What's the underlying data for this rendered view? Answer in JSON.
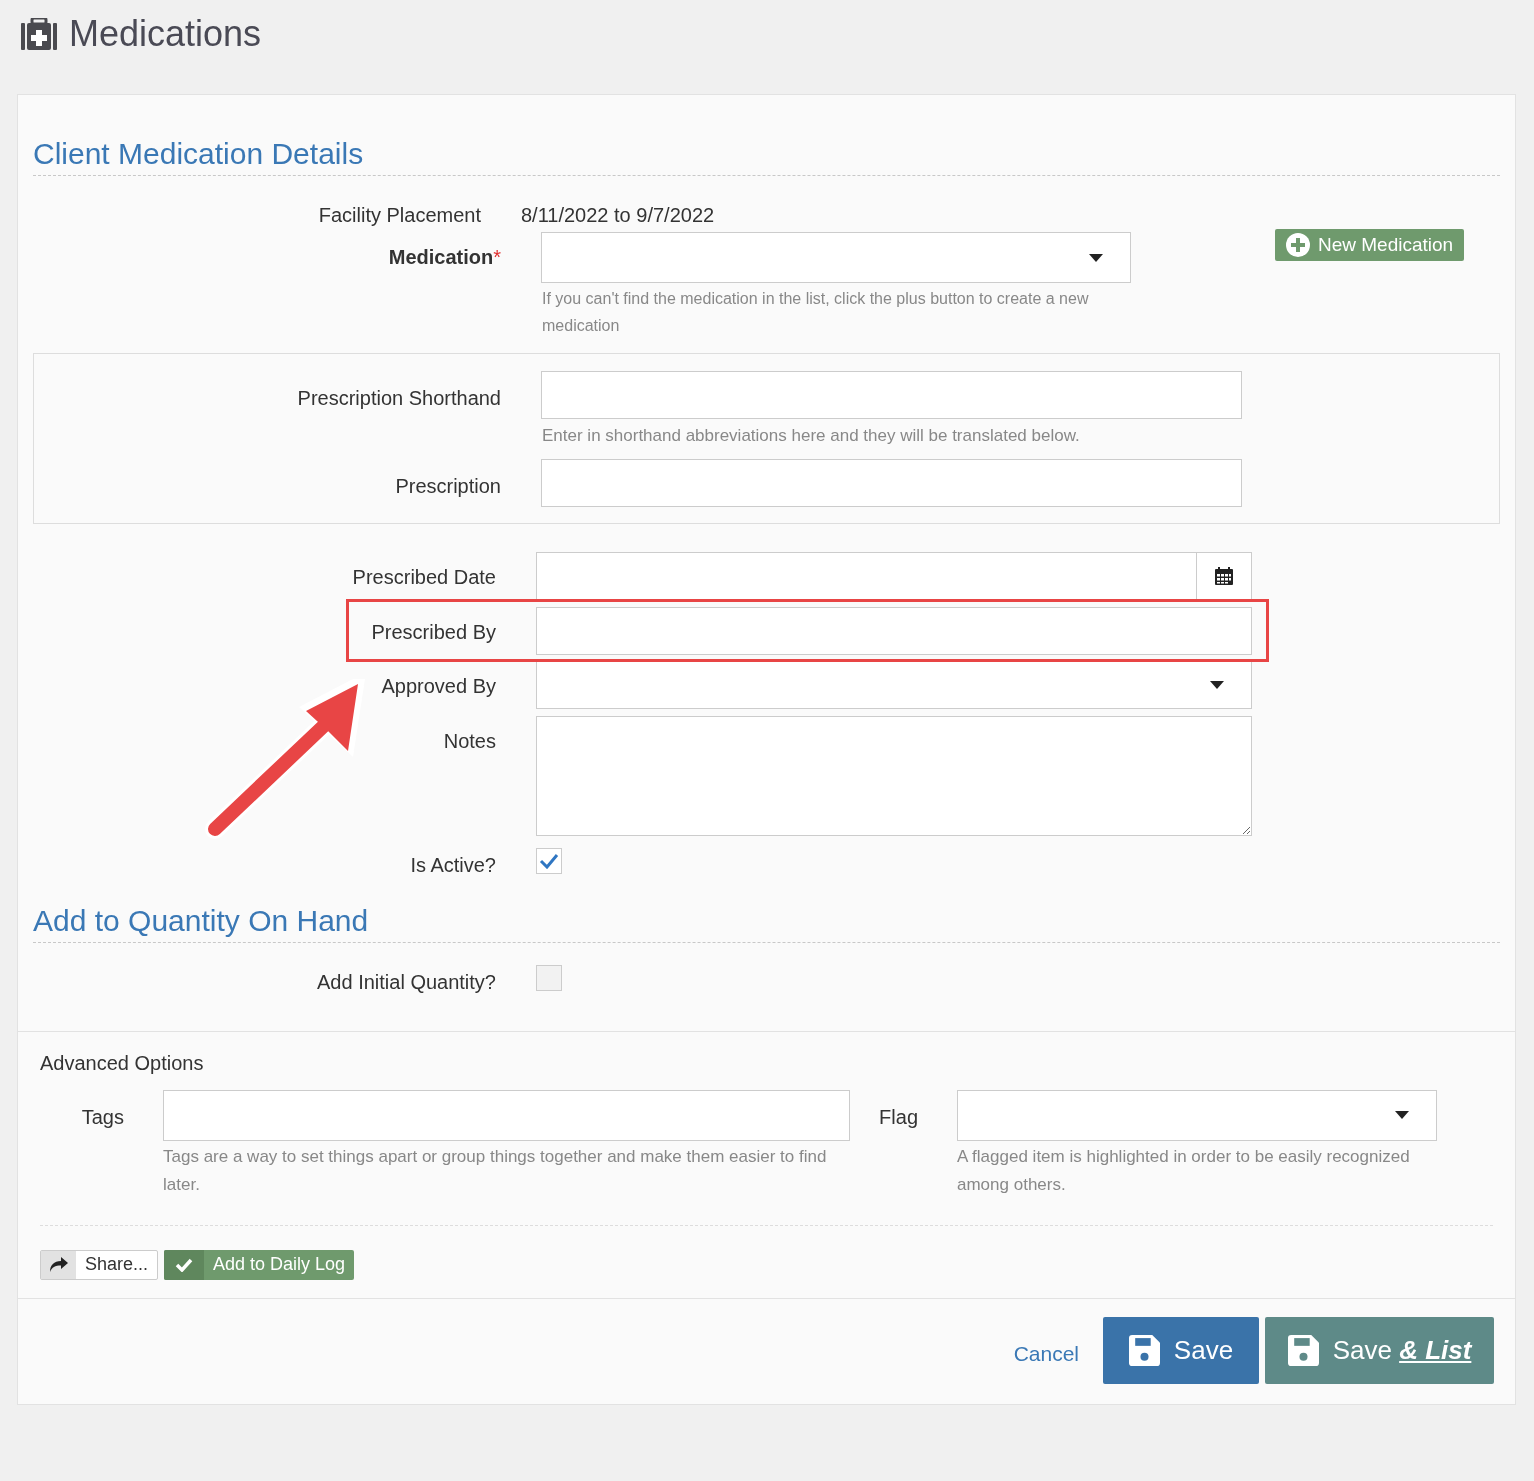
{
  "page": {
    "title": "Medications"
  },
  "details": {
    "title": "Client Medication Details",
    "facility_placement": {
      "label": "Facility Placement",
      "value": "8/11/2022 to 9/7/2022"
    },
    "medication": {
      "label": "Medication",
      "required": true,
      "required_mark": "*",
      "help": "If you can't find the medication in the list, click the plus button to create a new medication"
    },
    "new_medication_button": "New Medication",
    "prescription_panel": [
      {
        "label": "Prescription Shorthand",
        "help": "Enter in shorthand abbreviations here and they will be translated below."
      },
      {
        "label": "Prescription"
      }
    ],
    "fields": [
      {
        "kind": "date",
        "label": "Prescribed Date",
        "highlighted": false
      },
      {
        "kind": "text",
        "label": "Prescribed By",
        "highlighted": true
      },
      {
        "kind": "select",
        "label": "Approved By",
        "highlighted": false
      },
      {
        "kind": "textarea",
        "label": "Notes",
        "highlighted": false
      },
      {
        "kind": "checkbox",
        "label": "Is Active?",
        "checked": true,
        "highlighted": false
      }
    ]
  },
  "quantity": {
    "title": "Add to Quantity On Hand",
    "fields": [
      {
        "kind": "checkbox",
        "label": "Add Initial Quantity?",
        "checked": false
      }
    ]
  },
  "advanced": {
    "title": "Advanced Options",
    "tags": {
      "label": "Tags",
      "help": "Tags are a way to set things apart or group things together and make them easier to find later."
    },
    "flag": {
      "label": "Flag",
      "help": "A flagged item is highlighted in order to be easily recognized among others."
    }
  },
  "actions": {
    "share": "Share...",
    "daily_log": "Add to Daily Log"
  },
  "footer": {
    "cancel": "Cancel",
    "save": "Save",
    "save_list": {
      "label": "Save",
      "emphasis": "& List"
    }
  }
}
